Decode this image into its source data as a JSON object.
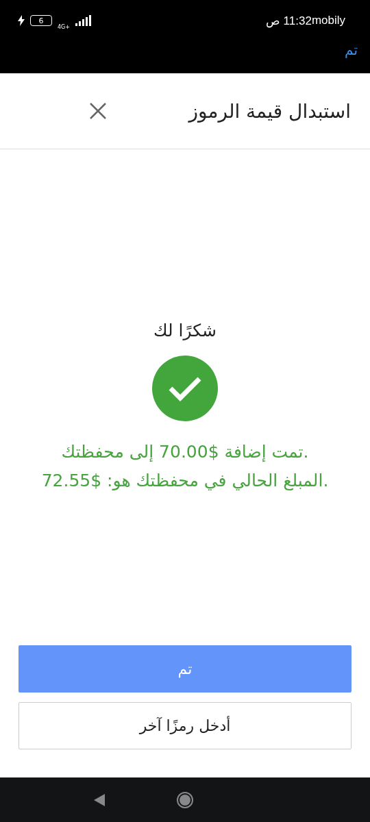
{
  "status_bar": {
    "battery": "6",
    "network": "4G+",
    "time": "11:32 ص",
    "carrier": "mobily"
  },
  "top_bar": {
    "done": "تم"
  },
  "header": {
    "title": "استبدال قيمة الرموز"
  },
  "result": {
    "heading": "شكرًا لك",
    "success": true,
    "messages": [
      "تمت إضافة $70.00 إلى محفظتك.",
      "المبلغ الحالي في محفظتك هو: $72.55."
    ]
  },
  "buttons": [
    {
      "label": "تم",
      "kind": "primary"
    },
    {
      "label": "أدخل رمزًا آخر",
      "kind": "secondary"
    }
  ]
}
